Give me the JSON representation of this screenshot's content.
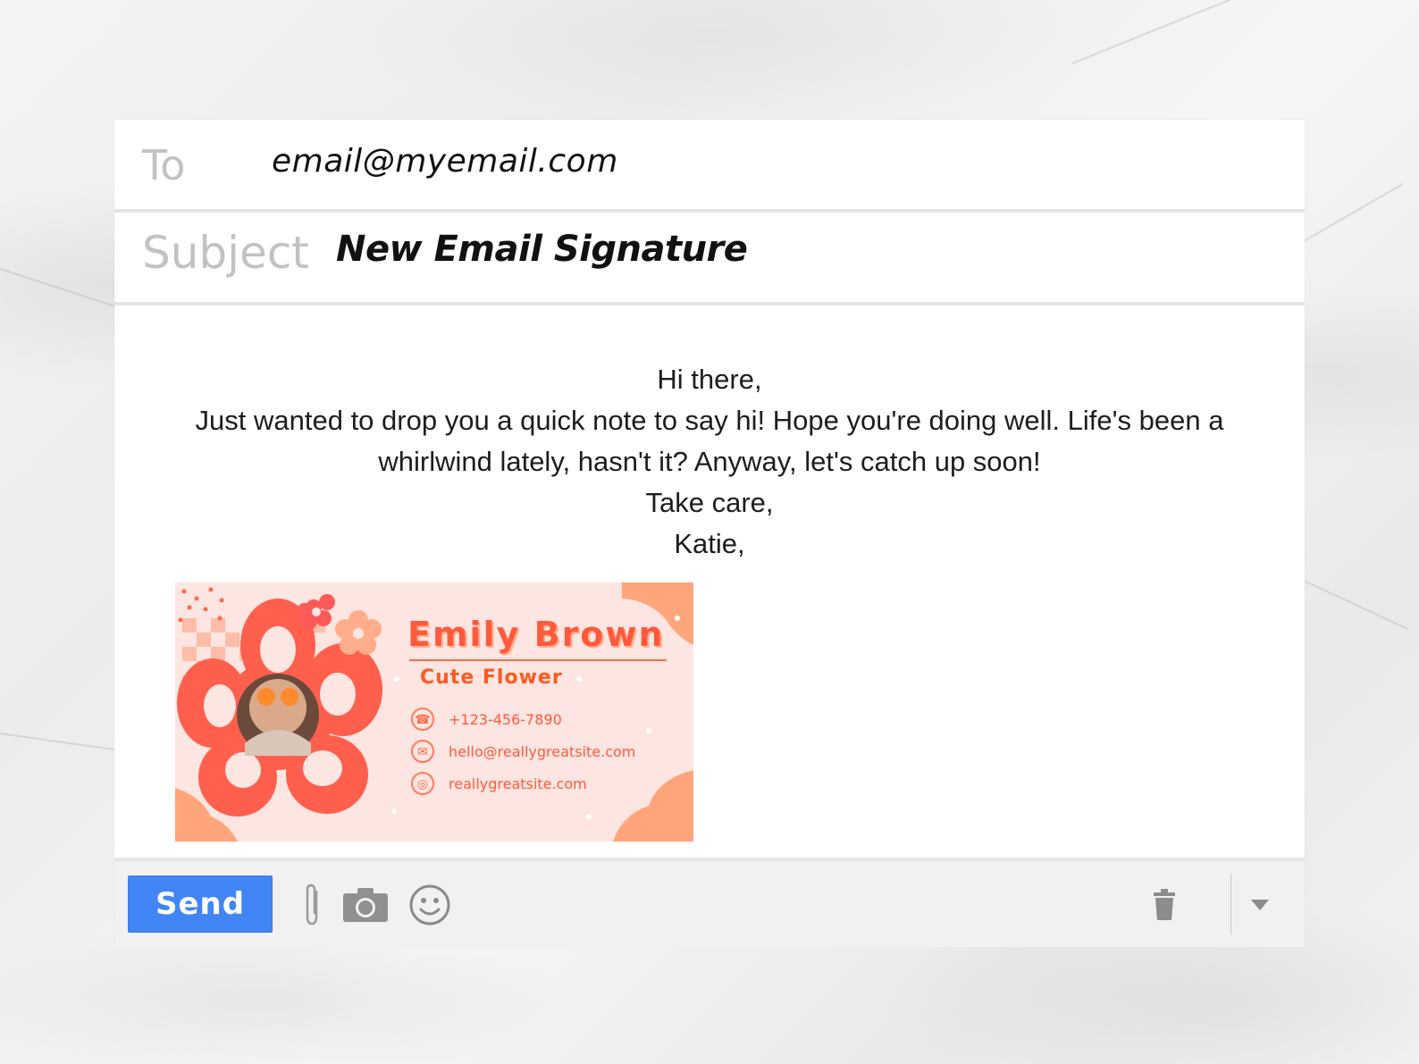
{
  "compose": {
    "to_label": "To",
    "to_value": "email@myemail.com",
    "subject_label": "Subject",
    "subject_value": "New Email Signature"
  },
  "body": {
    "greeting": "Hi there,",
    "paragraph_line1": "Just wanted to drop you a quick note to say hi! Hope you're doing well. Life's been a",
    "paragraph_line2": "whirlwind lately, hasn't it? Anyway, let's catch up soon!",
    "closing": "Take care,",
    "sender": "Katie,"
  },
  "signature": {
    "name": "Emily Brown",
    "tagline": "Cute Flower",
    "phone": "+123-456-7890",
    "email": "hello@reallygreatsite.com",
    "website": "reallygreatsite.com"
  },
  "toolbar": {
    "send_label": "Send",
    "icons": [
      "paperclip-icon",
      "camera-icon",
      "smiley-icon",
      "trash-icon",
      "caret-down-icon"
    ]
  },
  "colors": {
    "send_button": "#4285f4",
    "signature_accent": "#ff5a3c",
    "signature_background": "#fde5e1"
  }
}
